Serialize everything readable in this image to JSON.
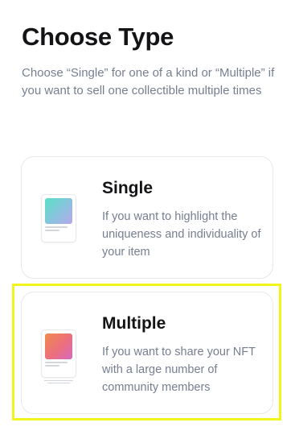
{
  "header": {
    "title": "Choose Type",
    "subtitle": "Choose “Single” for one of a kind or “Multiple” if you want to sell one collectible multiple times"
  },
  "options": [
    {
      "title": "Single",
      "description": "If you want to highlight the uniqueness and individuality of your item",
      "icon": "single-nft-card-icon",
      "gradient": [
        "#57e0c4",
        "#b7a8e8"
      ]
    },
    {
      "title": "Multiple",
      "description": "If you want to share your NFT with a large number of community members",
      "icon": "multiple-nft-stack-icon",
      "gradient": [
        "#f08a4b",
        "#d66ac0"
      ],
      "highlighted": true
    }
  ],
  "colors": {
    "text_primary": "#141416",
    "text_secondary": "#777e90",
    "card_border": "#e6e8ec",
    "highlight": "#f2f51a"
  }
}
